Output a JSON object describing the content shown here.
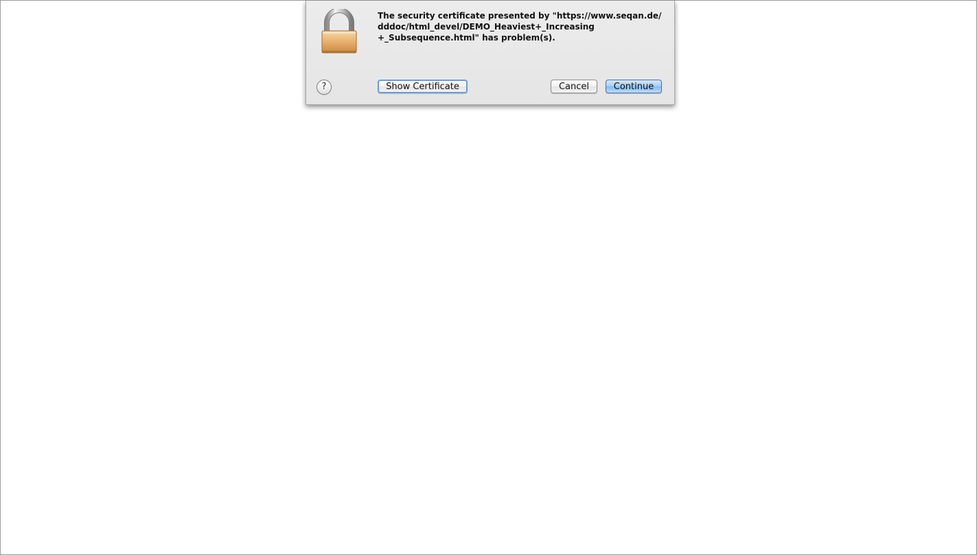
{
  "dialog": {
    "message_lines": [
      "The security certificate presented by \"https://www.seqan.de/",
      "dddoc/html_devel/DEMO_Heaviest+_Increasing",
      "+_Subsequence.html\" has problem(s)."
    ],
    "help_label": "?",
    "show_certificate_label": "Show Certificate",
    "cancel_label": "Cancel",
    "continue_label": "Continue",
    "icon": "padlock-icon"
  },
  "colors": {
    "sheet_bg": "#e8e8e8",
    "default_button": "#9cc7f4",
    "focus_ring": "#6a9bd8",
    "lock_body": "#e8b06c"
  }
}
